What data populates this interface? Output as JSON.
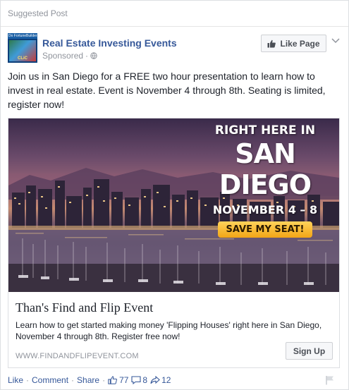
{
  "header": {
    "suggested_label": "Suggested Post"
  },
  "page": {
    "logo_top_text": "Do FortuneBuilders",
    "logo_text": "CLiC",
    "name": "Real Estate Investing Events",
    "sponsored_label": "Sponsored",
    "dot": "·",
    "like_button_label": "Like Page"
  },
  "post": {
    "text": "Join us in San Diego for a FREE two hour presentation to learn how to invest in real estate. Event is November 4 through 8th. Seating is limited, register now!"
  },
  "ad": {
    "overlay": {
      "line1": "RIGHT HERE IN",
      "line2": "SAN DIEGO",
      "line3": "NOVEMBER 4 – 8",
      "button": "SAVE MY SEAT!"
    },
    "title": "Than's Find and Flip Event",
    "description": "Learn how to get started making money 'Flipping Houses' right here in San Diego, November 4 through 8th. Register free now!",
    "url": "WWW.FINDANDFLIPEVENT.COM",
    "cta_label": "Sign Up"
  },
  "actions": {
    "like": "Like",
    "comment": "Comment",
    "share": "Share",
    "dot": "·",
    "likes_count": "77",
    "comments_count": "8",
    "shares_count": "12"
  },
  "colors": {
    "link": "#365899",
    "muted": "#90949c",
    "text": "#1d2129"
  }
}
